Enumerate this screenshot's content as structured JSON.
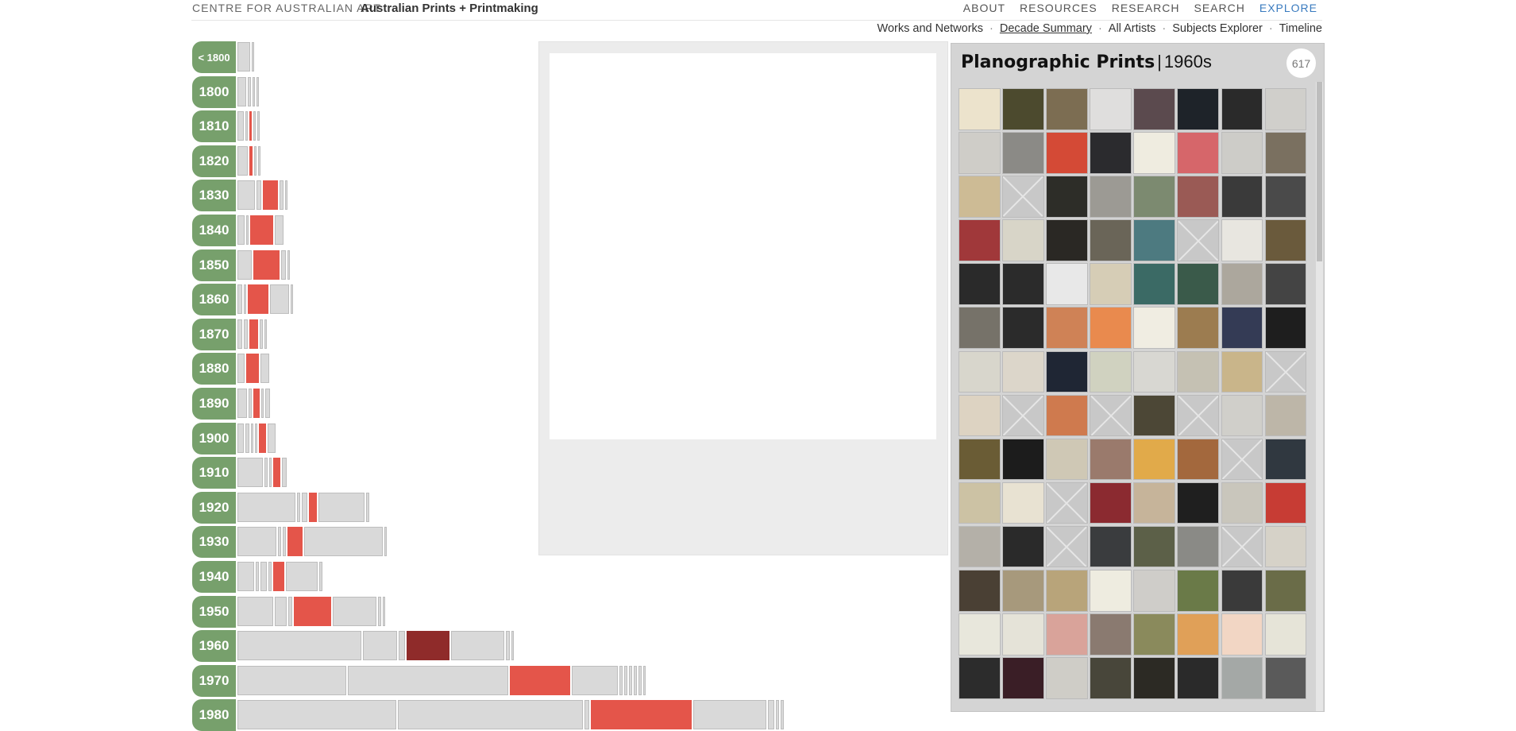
{
  "header": {
    "org": "CENTRE FOR AUSTRALIAN ART",
    "site": "Australian Prints + Printmaking",
    "nav": [
      "ABOUT",
      "RESOURCES",
      "RESEARCH",
      "SEARCH",
      "EXPLORE"
    ],
    "active_nav": "EXPLORE"
  },
  "subnav": {
    "items": [
      "Works and Networks",
      "Decade Summary",
      "All Artists",
      "Subjects Explorer",
      "Timeline"
    ],
    "current": "Decade Summary"
  },
  "decades": [
    {
      "label": "< 1800",
      "segments": [
        {
          "w": 16
        },
        {
          "w": 3
        }
      ]
    },
    {
      "label": "1800",
      "segments": [
        {
          "w": 11
        },
        {
          "w": 4
        },
        {
          "w": 3
        },
        {
          "w": 3
        }
      ]
    },
    {
      "label": "1810",
      "segments": [
        {
          "w": 8
        },
        {
          "w": 3
        },
        {
          "w": 3,
          "h": 1
        },
        {
          "w": 3
        },
        {
          "w": 3
        }
      ]
    },
    {
      "label": "1820",
      "segments": [
        {
          "w": 13
        },
        {
          "w": 4,
          "h": 1
        },
        {
          "w": 3
        },
        {
          "w": 3
        }
      ]
    },
    {
      "label": "1830",
      "segments": [
        {
          "w": 22
        },
        {
          "w": 6
        },
        {
          "w": 19,
          "h": 1
        },
        {
          "w": 5
        },
        {
          "w": 3
        }
      ]
    },
    {
      "label": "1840",
      "segments": [
        {
          "w": 9
        },
        {
          "w": 3
        },
        {
          "w": 29,
          "h": 1
        },
        {
          "w": 11
        }
      ]
    },
    {
      "label": "1850",
      "segments": [
        {
          "w": 18
        },
        {
          "w": 33,
          "h": 1
        },
        {
          "w": 6
        },
        {
          "w": 3
        }
      ]
    },
    {
      "label": "1860",
      "segments": [
        {
          "w": 6
        },
        {
          "w": 3
        },
        {
          "w": 26,
          "h": 1
        },
        {
          "w": 24
        },
        {
          "w": 3
        }
      ]
    },
    {
      "label": "1870",
      "segments": [
        {
          "w": 6
        },
        {
          "w": 5
        },
        {
          "w": 11,
          "h": 1
        },
        {
          "w": 4
        },
        {
          "w": 3
        }
      ]
    },
    {
      "label": "1880",
      "segments": [
        {
          "w": 9
        },
        {
          "w": 16,
          "h": 1
        },
        {
          "w": 11
        }
      ]
    },
    {
      "label": "1890",
      "segments": [
        {
          "w": 12
        },
        {
          "w": 4
        },
        {
          "w": 8,
          "h": 1
        },
        {
          "w": 3
        },
        {
          "w": 6
        }
      ]
    },
    {
      "label": "1900",
      "segments": [
        {
          "w": 8
        },
        {
          "w": 5
        },
        {
          "w": 3
        },
        {
          "w": 3
        },
        {
          "w": 9,
          "h": 1
        },
        {
          "w": 10
        }
      ]
    },
    {
      "label": "1910",
      "segments": [
        {
          "w": 32
        },
        {
          "w": 4
        },
        {
          "w": 3
        },
        {
          "w": 9,
          "h": 1
        },
        {
          "w": 6
        }
      ]
    },
    {
      "label": "1920",
      "segments": [
        {
          "w": 73
        },
        {
          "w": 4
        },
        {
          "w": 7
        },
        {
          "w": 10,
          "h": 1
        },
        {
          "w": 58
        },
        {
          "w": 4
        }
      ]
    },
    {
      "label": "1930",
      "segments": [
        {
          "w": 49
        },
        {
          "w": 4
        },
        {
          "w": 4
        },
        {
          "w": 19,
          "h": 1
        },
        {
          "w": 99
        },
        {
          "w": 3
        }
      ]
    },
    {
      "label": "1940",
      "segments": [
        {
          "w": 21
        },
        {
          "w": 4
        },
        {
          "w": 8
        },
        {
          "w": 4
        },
        {
          "w": 14,
          "h": 1
        },
        {
          "w": 40
        },
        {
          "w": 4
        }
      ]
    },
    {
      "label": "1950",
      "segments": [
        {
          "w": 45
        },
        {
          "w": 15
        },
        {
          "w": 5
        },
        {
          "w": 47,
          "h": 1
        },
        {
          "w": 55
        },
        {
          "w": 4
        },
        {
          "w": 3
        }
      ]
    },
    {
      "label": "1960",
      "segments": [
        {
          "w": 156
        },
        {
          "w": 43
        },
        {
          "w": 8
        },
        {
          "w": 54,
          "h": 2
        },
        {
          "w": 67
        },
        {
          "w": 5
        },
        {
          "w": 3
        }
      ]
    },
    {
      "label": "1970",
      "segments": [
        {
          "w": 137
        },
        {
          "w": 202
        },
        {
          "w": 76,
          "h": 1
        },
        {
          "w": 58
        },
        {
          "w": 4
        },
        {
          "w": 4
        },
        {
          "w": 4
        },
        {
          "w": 4
        },
        {
          "w": 4
        },
        {
          "w": 3
        }
      ]
    },
    {
      "label": "1980",
      "segments": [
        {
          "w": 200
        },
        {
          "w": 233
        },
        {
          "w": 6
        },
        {
          "w": 127,
          "h": 1
        },
        {
          "w": 92
        },
        {
          "w": 8
        },
        {
          "w": 4
        },
        {
          "w": 4
        }
      ]
    }
  ],
  "panel": {
    "title": "Planographic Prints",
    "decade": "1960s",
    "count": "617",
    "thumbs": [
      "#ece3cc",
      "#4c4a2e",
      "#7c6d52",
      "#dfdedd",
      "#5b4a4e",
      "#1e2329",
      "#2a2a2a",
      "#d0cfcb",
      "#cfcdc8",
      "#8b8a86",
      "#d44a36",
      "#2b2b2e",
      "#efece0",
      "#d6666a",
      "#cdccc8",
      "#7a7060",
      "#cdbb95",
      "#x",
      "#2d2d28",
      "#9c9a94",
      "#7c8a70",
      "#9a5a55",
      "#3a3a3a",
      "#4a4a4a",
      "#a0383a",
      "#d8d5c8",
      "#2a2824",
      "#6a6558",
      "#4d7a80",
      "#x",
      "#e8e6e0",
      "#6a5a3c",
      "#2a2a2a",
      "#2b2b2b",
      "#e8e8e8",
      "#d6cdb6",
      "#3b6a65",
      "#3a5a4a",
      "#aca79d",
      "#444444",
      "#767269",
      "#2b2b2b",
      "#cf8256",
      "#e98a4e",
      "#f0ede2",
      "#9c7c50",
      "#343b55",
      "#1e1e1e",
      "#d8d6cc",
      "#dcd6ca",
      "#1f2634",
      "#d0d2c0",
      "#d8d7d2",
      "#c5c1b3",
      "#c9b58a",
      "#x",
      "#ddd3c2",
      "#x",
      "#cf7a4e",
      "#x",
      "#4c4736",
      "#x",
      "#d0cfca",
      "#bdb6a8",
      "#6a5c35",
      "#1c1c1c",
      "#cfc8b5",
      "#9a7a6c",
      "#e1aa4a",
      "#a3683d",
      "#x",
      "#303840",
      "#ccc2a4",
      "#e8e2d2",
      "#x",
      "#8b2a30",
      "#c6b49a",
      "#1f1f1f",
      "#c9c6bc",
      "#c73c34",
      "#b4b0a8",
      "#2a2a2a",
      "#x",
      "#3a3c3e",
      "#5c6048",
      "#8a8a86",
      "#x",
      "#d6d2c8",
      "#4a4034",
      "#a7997c",
      "#b8a47a",
      "#eeece0",
      "#cfcdc9",
      "#6a7a48",
      "#3a3a3a",
      "#6a6c48",
      "#e8e7dc",
      "#e5e3d8",
      "#d9a39a",
      "#8a7a70",
      "#8a8a5c",
      "#e0a058",
      "#f2d6c4",
      "#e6e4d8",
      "#2c2c2c",
      "#3a1e26",
      "#cfcdc7",
      "#48463a",
      "#2c2a24",
      "#2a2a2a",
      "#a4a8a6",
      "#5a5a5a"
    ]
  }
}
